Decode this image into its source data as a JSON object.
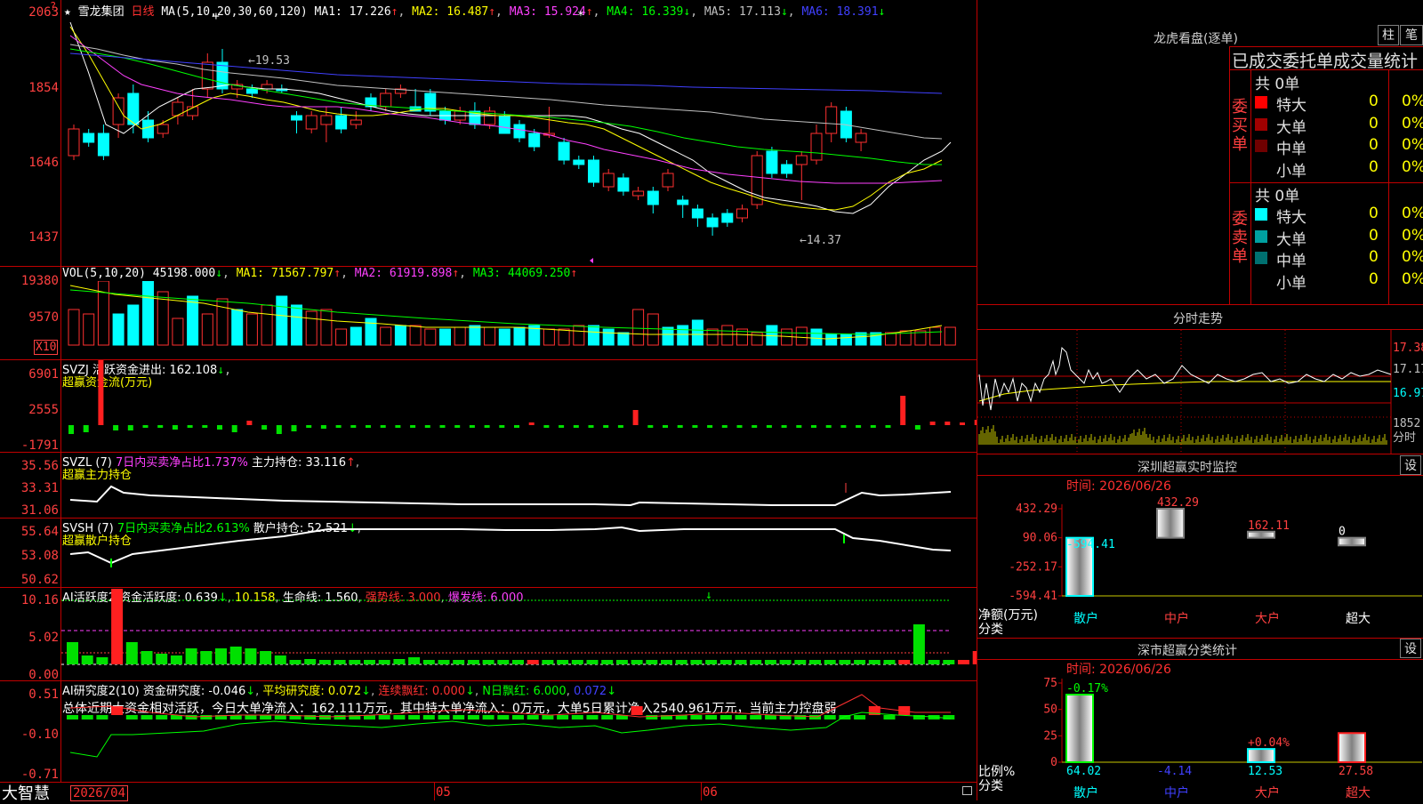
{
  "stock": {
    "name": "雪龙集团",
    "period": "日线",
    "star": "★",
    "q_marks": [
      "?",
      "?"
    ]
  },
  "main_chart": {
    "ma_label": "MA(5,10,20,30,60,120)",
    "ma": [
      {
        "label": "MA1: 17.226",
        "arrow": "↑",
        "color": "#ffffff"
      },
      {
        "label": "MA2: 16.487",
        "arrow": "↑",
        "color": "#ffff00"
      },
      {
        "label": "MA3: 15.924",
        "arrow": "↑",
        "color": "#ff40ff"
      },
      {
        "label": "MA4: 16.339",
        "arrow": "↓",
        "color": "#00ff00"
      },
      {
        "label": "MA5: 17.113",
        "arrow": "↓",
        "color": "#c0c0c0"
      },
      {
        "label": "MA6: 18.391",
        "arrow": "↓",
        "color": "#4040ff"
      }
    ],
    "y_ticks": [
      "2063",
      "1854",
      "1646",
      "1437"
    ],
    "high_label": "←19.53",
    "low_label": "←14.37"
  },
  "vol_panel": {
    "label": "VOL(5,10,20)",
    "value": "45198.000",
    "value_arrow": "↓",
    "ma1": "MA1: 71567.797",
    "ma1_arrow": "↑",
    "ma2": "MA2: 61919.898",
    "ma2_arrow": "↑",
    "ma3": "MA3: 44069.250",
    "ma3_arrow": "↑",
    "y_ticks": [
      "19380",
      "9570"
    ],
    "unit": "X10"
  },
  "svzj_panel": {
    "line1": "SVZJ  活跃资金进出: 162.108",
    "line1_arrow": "↓",
    "line2": "超赢资金流(万元)",
    "y_ticks": [
      "6901",
      "2555",
      "-1791"
    ]
  },
  "svzl_panel": {
    "label": "SVZL (7)",
    "text1": "7日内买卖净占比1.737%",
    "text2": "主力持仓: 33.116",
    "arrow": "↑",
    "line2": "超赢主力持仓",
    "y_ticks": [
      "35.56",
      "33.31",
      "31.06"
    ]
  },
  "svsh_panel": {
    "label": "SVSH (7)",
    "text1": "7日内买卖净占比2.613%",
    "text2": "散户持仓: 52.521",
    "arrow": "↓",
    "line2": "超赢散户持仓",
    "y_ticks": [
      "55.64",
      "53.08",
      "50.62"
    ]
  },
  "ai_active": {
    "label": "AI活跃度2",
    "t1": "资金活跃度: 0.639",
    "t1a": "↓",
    "t2": "10.158",
    "t3": "生命线: 1.560",
    "t4": "强势线: 3.000",
    "t5": "爆发线: 6.000",
    "y_ticks": [
      "10.16",
      "5.02",
      "0.00"
    ]
  },
  "ai_research": {
    "label": "AI研究度2(10)",
    "t1": "资金研究度: -0.046",
    "t1a": "↓",
    "t2": "平均研究度: 0.072",
    "t2a": "↓",
    "t3": "连续飘红: 0.000",
    "t3a": "↓",
    "t4": "N日飘红: 6.000",
    "t5": "0.072",
    "t5a": "↓",
    "summary": "总体近期大资金相对活跃，今日大单净流入：162.111万元，其中特大单净流入：0万元，大单5日累计净入2540.961万元，当前主力控盘弱",
    "y_ticks": [
      "0.51",
      "-0.10",
      "-0.71"
    ]
  },
  "x_axis": {
    "labels": [
      "2026/04",
      "05",
      "06"
    ]
  },
  "brand": "大智慧",
  "right_panel": {
    "header_title": "龙虎看盘(逐单)",
    "btn1": "柱",
    "btn2": "笔",
    "stats_title": "已成交委托单成交量统计",
    "buy": {
      "side": "委买单",
      "count_label": "共 0单",
      "rows": [
        {
          "name": "特大",
          "qty": "0",
          "pct": "0%",
          "color": "#ff0000"
        },
        {
          "name": "大单",
          "qty": "0",
          "pct": "0%",
          "color": "#a00000"
        },
        {
          "name": "中单",
          "qty": "0",
          "pct": "0%",
          "color": "#700000"
        },
        {
          "name": "小单",
          "qty": "0",
          "pct": "0%",
          "color": ""
        }
      ]
    },
    "sell": {
      "side": "委卖单",
      "count_label": "共 0单",
      "rows": [
        {
          "name": "特大",
          "qty": "0",
          "pct": "0%",
          "color": "#00ffff"
        },
        {
          "name": "大单",
          "qty": "0",
          "pct": "0%",
          "color": "#00a0a0"
        },
        {
          "name": "中单",
          "qty": "0",
          "pct": "0%",
          "color": "#007070"
        },
        {
          "name": "小单",
          "qty": "0",
          "pct": "0%",
          "color": ""
        }
      ]
    },
    "intraday_title": "分时走势",
    "intraday_ticks": [
      "17.38",
      "17.17",
      "16.97",
      "1852",
      "分时"
    ],
    "sz_monitor": {
      "title": "深圳超赢实时监控",
      "set": "设",
      "time": "时间: 2026/06/26",
      "y_ticks": [
        "432.29",
        "90.06",
        "-252.17",
        "-594.41"
      ],
      "ylabel1": "净额(万元)",
      "ylabel2": "分类",
      "categories": [
        "散户",
        "中户",
        "大户",
        "超大"
      ],
      "values": [
        -594.41,
        432.29,
        162.11,
        0
      ],
      "value_labels": [
        "-594.41",
        "432.29",
        "162.11",
        "0"
      ]
    },
    "sz_class": {
      "title": "深市超赢分类统计",
      "set": "设",
      "time": "时间: 2026/06/26",
      "y_ticks": [
        "75",
        "50",
        "25",
        "0"
      ],
      "ylabel1": "比例%",
      "ylabel2": "分类",
      "categories": [
        "散户",
        "中户",
        "大户",
        "超大"
      ],
      "values": [
        64.02,
        -4.14,
        12.53,
        27.58
      ],
      "value_labels": [
        "64.02",
        "-4.14",
        "12.53",
        "27.58"
      ],
      "change_labels": [
        "-0.17%",
        "",
        "+0.04%",
        ""
      ]
    }
  },
  "chart_data": [
    {
      "type": "bar",
      "title": "深圳超赢实时监控",
      "ylabel": "净额(万元)",
      "categories": [
        "散户",
        "中户",
        "大户",
        "超大"
      ],
      "values": [
        -594.41,
        432.29,
        162.11,
        0
      ],
      "ylim": [
        -594.41,
        432.29
      ]
    },
    {
      "type": "bar",
      "title": "深市超赢分类统计",
      "ylabel": "比例%",
      "categories": [
        "散户",
        "中户",
        "大户",
        "超大"
      ],
      "values": [
        64.02,
        -4.14,
        12.53,
        27.58
      ],
      "ylim": [
        0,
        75
      ]
    }
  ]
}
